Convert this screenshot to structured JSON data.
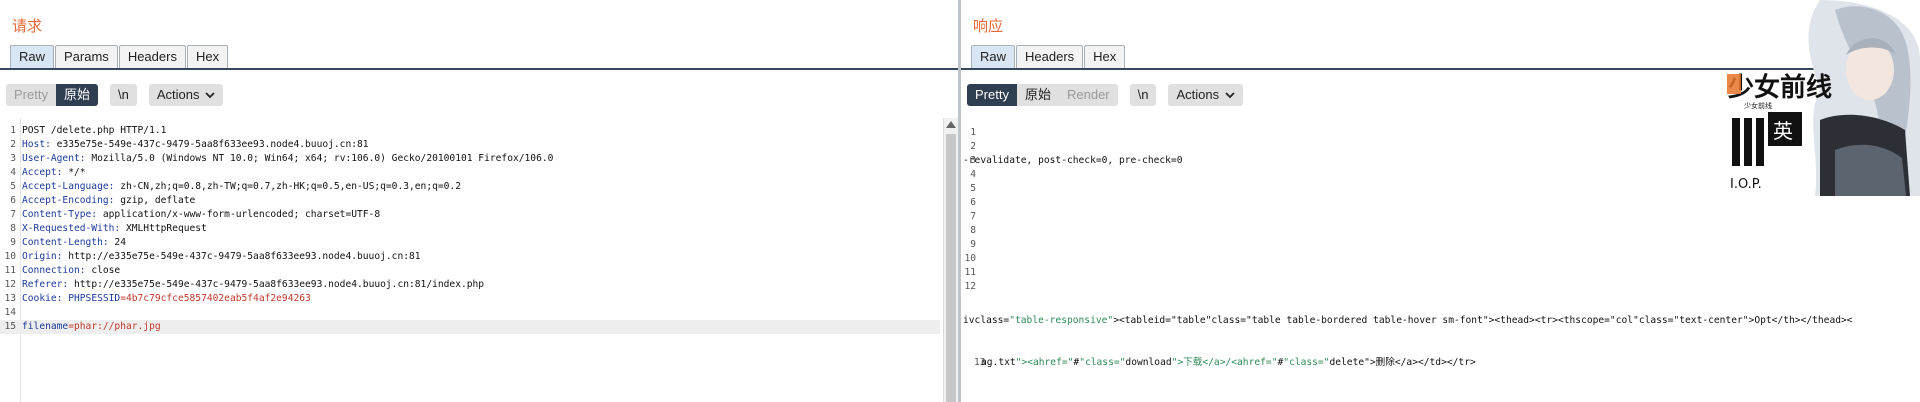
{
  "request": {
    "title": "请求",
    "tabs": [
      "Raw",
      "Params",
      "Headers",
      "Hex"
    ],
    "toolbar": {
      "pretty": "Pretty",
      "raw": "原始",
      "newline": "\\n",
      "actions": "Actions"
    },
    "lines": [
      {
        "n": "1",
        "key": "",
        "val": "POST /delete.php HTTP/1.1"
      },
      {
        "n": "2",
        "key": "Host:",
        "val": " e335e75e-549e-437c-9479-5aa8f633ee93.node4.buuoj.cn:81"
      },
      {
        "n": "3",
        "key": "User-Agent:",
        "val": " Mozilla/5.0 (Windows NT 10.0; Win64; x64; rv:106.0) Gecko/20100101 Firefox/106.0"
      },
      {
        "n": "4",
        "key": "Accept:",
        "val": " */*"
      },
      {
        "n": "5",
        "key": "Accept-Language:",
        "val": " zh-CN,zh;q=0.8,zh-TW;q=0.7,zh-HK;q=0.5,en-US;q=0.3,en;q=0.2"
      },
      {
        "n": "6",
        "key": "Accept-Encoding:",
        "val": " gzip, deflate"
      },
      {
        "n": "7",
        "key": "Content-Type:",
        "val": " application/x-www-form-urlencoded; charset=UTF-8"
      },
      {
        "n": "8",
        "key": "X-Requested-With:",
        "val": " XMLHttpRequest"
      },
      {
        "n": "9",
        "key": "Content-Length:",
        "val": " 24"
      },
      {
        "n": "10",
        "key": "Origin:",
        "val": " http://e335e75e-549e-437c-9479-5aa8f633ee93.node4.buuoj.cn:81"
      },
      {
        "n": "11",
        "key": "Connection:",
        "val": " close"
      },
      {
        "n": "12",
        "key": "Referer:",
        "val": " http://e335e75e-549e-437c-9479-5aa8f633ee93.node4.buuoj.cn:81/index.php"
      },
      {
        "n": "13",
        "key": "Cookie:",
        "val": " ",
        "ck": "PHPSESSID",
        "cv": "=4b7c79cfce5857402eab5f4af2e94263"
      },
      {
        "n": "14",
        "key": "",
        "val": ""
      },
      {
        "n": "15",
        "key": "filename",
        "val": "",
        "pv": "=phar://phar.jpg"
      }
    ]
  },
  "response": {
    "title": "响应",
    "tabs": [
      "Raw",
      "Headers",
      "Hex"
    ],
    "toolbar": {
      "pretty": "Pretty",
      "raw": "原始",
      "render": "Render",
      "newline": "\\n",
      "actions": "Actions"
    },
    "line_numbers": [
      "1",
      "2",
      "3",
      "4",
      "5",
      "6",
      "7",
      "8",
      "9",
      "10",
      "11",
      "12"
    ],
    "line6": "-revalidate, post-check=0, pre-check=0",
    "html_line": "ivclass=\"table-responsive\"><tableid=\"table\"class=\"table table-bordered table-hover sm-font\"><thead><tr><thscope=\"col\"class=\"text-center\">Opt</th></thead><",
    "line13_num": "13",
    "line13": "ag.txt\"><ahref=\"#\"class=\"download\">下载</a>/<ahref=\"#\"class=\"delete\">删除</a></td></tr>"
  },
  "overlay": {
    "logo_text": "少女前线",
    "logo_sub": "少女前线",
    "iop_text": "I.O.P.",
    "badge_text": "英"
  }
}
